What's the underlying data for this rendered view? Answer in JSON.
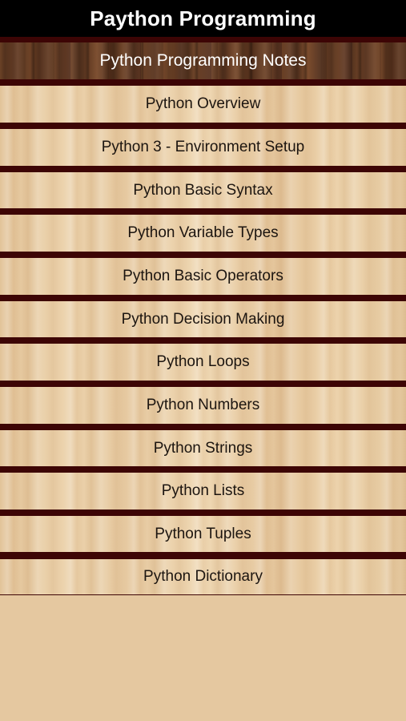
{
  "app_bar": {
    "title": "Paython Programming"
  },
  "header": {
    "label": "Python Programming Notes"
  },
  "menu": {
    "items": [
      {
        "label": "Python Overview"
      },
      {
        "label": "Python 3 - Environment Setup"
      },
      {
        "label": "Python Basic Syntax"
      },
      {
        "label": "Python Variable Types"
      },
      {
        "label": "Python Basic Operators"
      },
      {
        "label": "Python Decision Making"
      },
      {
        "label": "Python Loops"
      },
      {
        "label": "Python Numbers"
      },
      {
        "label": "Python Strings"
      },
      {
        "label": "Python Lists"
      },
      {
        "label": "Python Tuples"
      },
      {
        "label": "Python Dictionary"
      }
    ]
  },
  "colors": {
    "app_bar_bg": "#000000",
    "divider": "#3d0505",
    "item_text": "#1c1510",
    "header_text": "#ffffff",
    "background": "#e5c9a1"
  }
}
